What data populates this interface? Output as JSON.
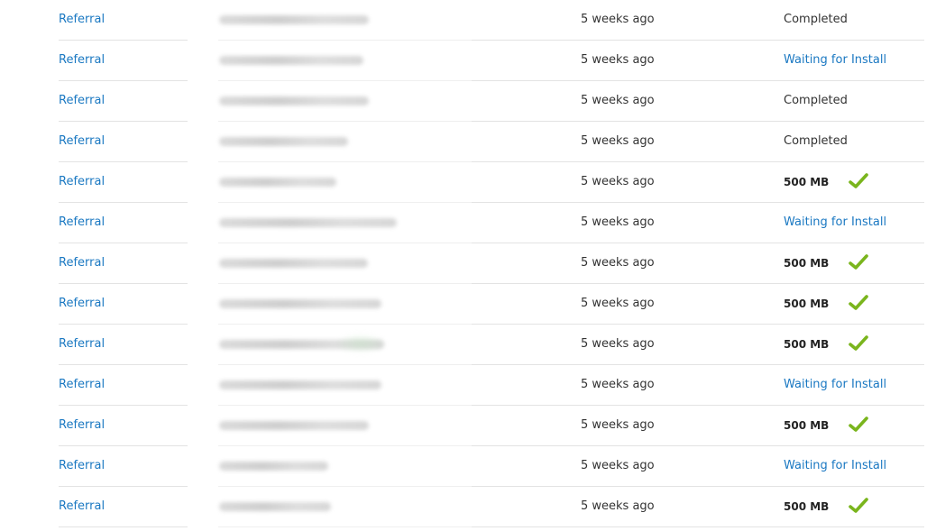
{
  "colors": {
    "link": "#1a78c2",
    "text": "#333333",
    "check": "#7ab51d",
    "divider": "#e3e3e3"
  },
  "rows": [
    {
      "type": "Referral",
      "time": "5 weeks ago",
      "status": "Completed",
      "status_kind": "completed"
    },
    {
      "type": "Referral",
      "time": "5 weeks ago",
      "status": "Waiting for Install",
      "status_kind": "waiting"
    },
    {
      "type": "Referral",
      "time": "5 weeks ago",
      "status": "Completed",
      "status_kind": "completed"
    },
    {
      "type": "Referral",
      "time": "5 weeks ago",
      "status": "Completed",
      "status_kind": "completed"
    },
    {
      "type": "Referral",
      "time": "5 weeks ago",
      "status": "500 MB",
      "status_kind": "reward",
      "icon": "checkmark-icon"
    },
    {
      "type": "Referral",
      "time": "5 weeks ago",
      "status": "Waiting for Install",
      "status_kind": "waiting"
    },
    {
      "type": "Referral",
      "time": "5 weeks ago",
      "status": "500 MB",
      "status_kind": "reward",
      "icon": "checkmark-icon"
    },
    {
      "type": "Referral",
      "time": "5 weeks ago",
      "status": "500 MB",
      "status_kind": "reward",
      "icon": "checkmark-icon"
    },
    {
      "type": "Referral",
      "time": "5 weeks ago",
      "status": "500 MB",
      "status_kind": "reward",
      "icon": "checkmark-icon"
    },
    {
      "type": "Referral",
      "time": "5 weeks ago",
      "status": "Waiting for Install",
      "status_kind": "waiting"
    },
    {
      "type": "Referral",
      "time": "5 weeks ago",
      "status": "500 MB",
      "status_kind": "reward",
      "icon": "checkmark-icon"
    },
    {
      "type": "Referral",
      "time": "5 weeks ago",
      "status": "Waiting for Install",
      "status_kind": "waiting"
    },
    {
      "type": "Referral",
      "time": "5 weeks ago",
      "status": "500 MB",
      "status_kind": "reward",
      "icon": "checkmark-icon"
    }
  ]
}
